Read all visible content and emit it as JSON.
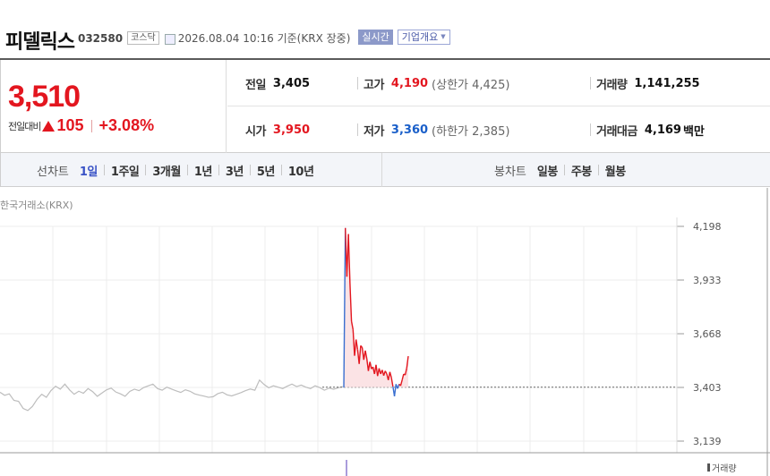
{
  "header": {
    "company_name": "피델릭스",
    "stock_code": "032580",
    "market": "코스닥",
    "date_text": "2026.08.04 10:16  기준(KRX 장중)",
    "realtime_label": "실시간",
    "overview_label": "기업개요",
    "clock_icon": "clock-icon"
  },
  "price": {
    "current": "3,510",
    "change_label": "전일대비",
    "change_direction": "up",
    "change_amount": "105",
    "change_rate": "+3.08%"
  },
  "stats": {
    "prev_close": {
      "label": "전일",
      "value": "3,405"
    },
    "high": {
      "label": "고가",
      "value": "4,190",
      "limit_text": "(상한가 4,425)"
    },
    "volume": {
      "label": "거래량",
      "value": "1,141,255"
    },
    "open": {
      "label": "시가",
      "value": "3,950"
    },
    "low": {
      "label": "저가",
      "value": "3,360",
      "limit_text": "(하한가 2,385)"
    },
    "trade_value": {
      "label": "거래대금",
      "value": "4,169",
      "unit": "백만"
    }
  },
  "periods": {
    "line_title": "선차트",
    "line_tabs": [
      "1일",
      "1주일",
      "3개월",
      "1년",
      "3년",
      "5년",
      "10년"
    ],
    "active_line_tab": 0,
    "candle_title": "봉차트",
    "candle_tabs": [
      "일봉",
      "주봉",
      "월봉"
    ]
  },
  "chart_data": {
    "type": "line",
    "source": "한국거래소(KRX)",
    "y_ticks": [
      "4,198",
      "3,933",
      "3,668",
      "3,403",
      "3,139"
    ],
    "ylim": [
      3139,
      4198
    ],
    "reference_price": 3405,
    "volume_legend": "거래량",
    "colors": {
      "up": "#e3161f",
      "down": "#3a6fd0",
      "prev_day": "#bdbdbd",
      "reference": "#666666",
      "fill": "#fbe3e5"
    },
    "prev_day_series": [
      3380,
      3365,
      3372,
      3340,
      3335,
      3300,
      3290,
      3310,
      3345,
      3370,
      3355,
      3388,
      3410,
      3395,
      3420,
      3392,
      3370,
      3385,
      3375,
      3398,
      3383,
      3360,
      3376,
      3392,
      3400,
      3381,
      3372,
      3360,
      3384,
      3395,
      3388,
      3403,
      3412,
      3420,
      3398,
      3390,
      3405,
      3396,
      3387,
      3379,
      3392,
      3385,
      3372,
      3366,
      3361,
      3355,
      3358,
      3373,
      3380,
      3367,
      3362,
      3370,
      3378,
      3388,
      3396,
      3390,
      3440,
      3418,
      3402,
      3412,
      3405,
      3398,
      3410,
      3420,
      3408,
      3415,
      3405,
      3398,
      3412,
      3403,
      3390,
      3400,
      3395,
      3402,
      3408
    ],
    "today_series": [
      3403,
      4190,
      3950,
      4160,
      3920,
      3730,
      3690,
      3560,
      3640,
      3590,
      3520,
      3610,
      3600,
      3540,
      3585,
      3545,
      3485,
      3530,
      3495,
      3505,
      3470,
      3515,
      3460,
      3498,
      3470,
      3490,
      3462,
      3485,
      3470,
      3440,
      3480,
      3452,
      3408,
      3360,
      3420,
      3398,
      3420,
      3412,
      3440,
      3470,
      3465,
      3500,
      3558
    ]
  }
}
